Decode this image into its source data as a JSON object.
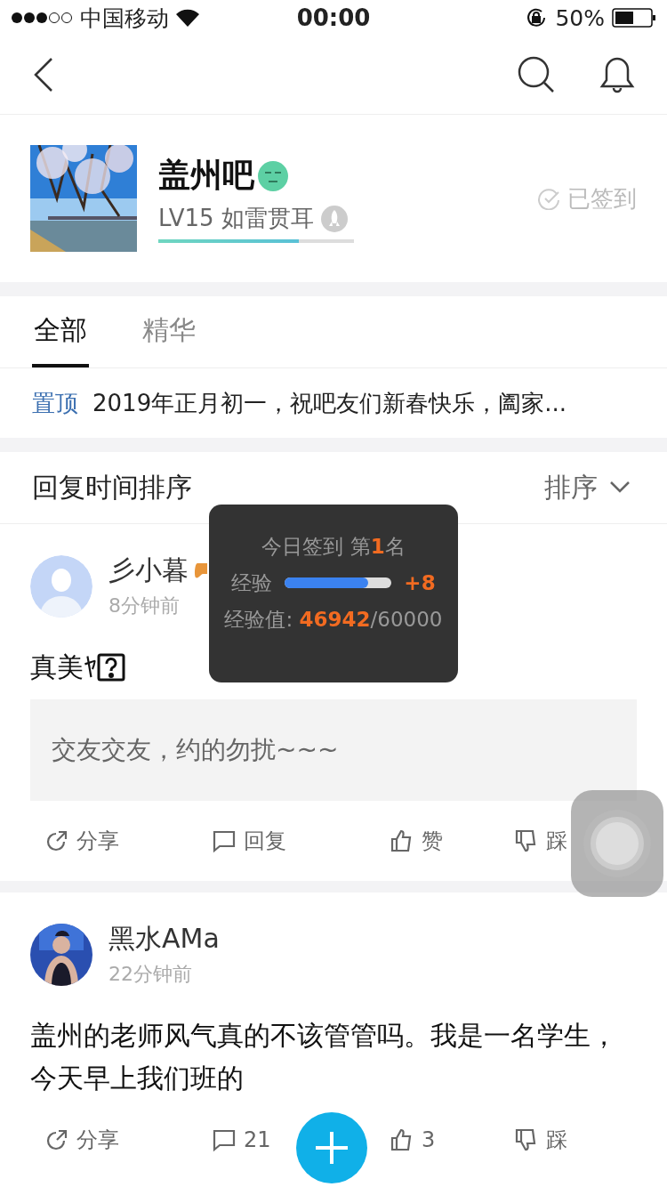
{
  "status_bar": {
    "carrier": "中国移动",
    "time": "00:00",
    "battery": "50%"
  },
  "forum": {
    "name": "盖州吧",
    "level_text": "LV15 如雷贯耳",
    "level": 0.72,
    "sign_in": "已签到"
  },
  "tabs": [
    {
      "label": "全部",
      "selected": true
    },
    {
      "label": "精华",
      "selected": false
    }
  ],
  "pinned": {
    "tag": "置顶",
    "title": "2019年正月初一，祝吧友们新春快乐，阖家..."
  },
  "sort_bar": {
    "title": "回复时间排序",
    "button": "排序"
  },
  "posts": [
    {
      "author": "彡小暮",
      "badge": true,
      "time": "8分钟前",
      "avatar": {
        "kind": "default"
      },
      "content": "真美ﾔ",
      "missing_glyph": true,
      "quote": "交友交友，约的勿扰~~~",
      "actions": [
        {
          "kind": "share",
          "label": "分享"
        },
        {
          "kind": "reply",
          "label": "回复"
        },
        {
          "kind": "like",
          "label": "赞"
        },
        {
          "kind": "dislike",
          "label": "踩"
        }
      ]
    },
    {
      "author": "黑水AMa",
      "time": "22分钟前",
      "content": "盖州的老师风气真的不该管管吗。我是一名学生，今天早上我们班的",
      "actions": [
        {
          "kind": "share",
          "label": "分享"
        },
        {
          "kind": "reply",
          "label": "21"
        },
        {
          "kind": "like",
          "label": "3"
        },
        {
          "kind": "dislike",
          "label": "踩"
        }
      ]
    }
  ],
  "toast": {
    "title": "今日签到 第**1**名",
    "exp_label": "经验",
    "level": 0.78,
    "gain": "+8",
    "exp_value": "经验值: **46942**/60000"
  }
}
